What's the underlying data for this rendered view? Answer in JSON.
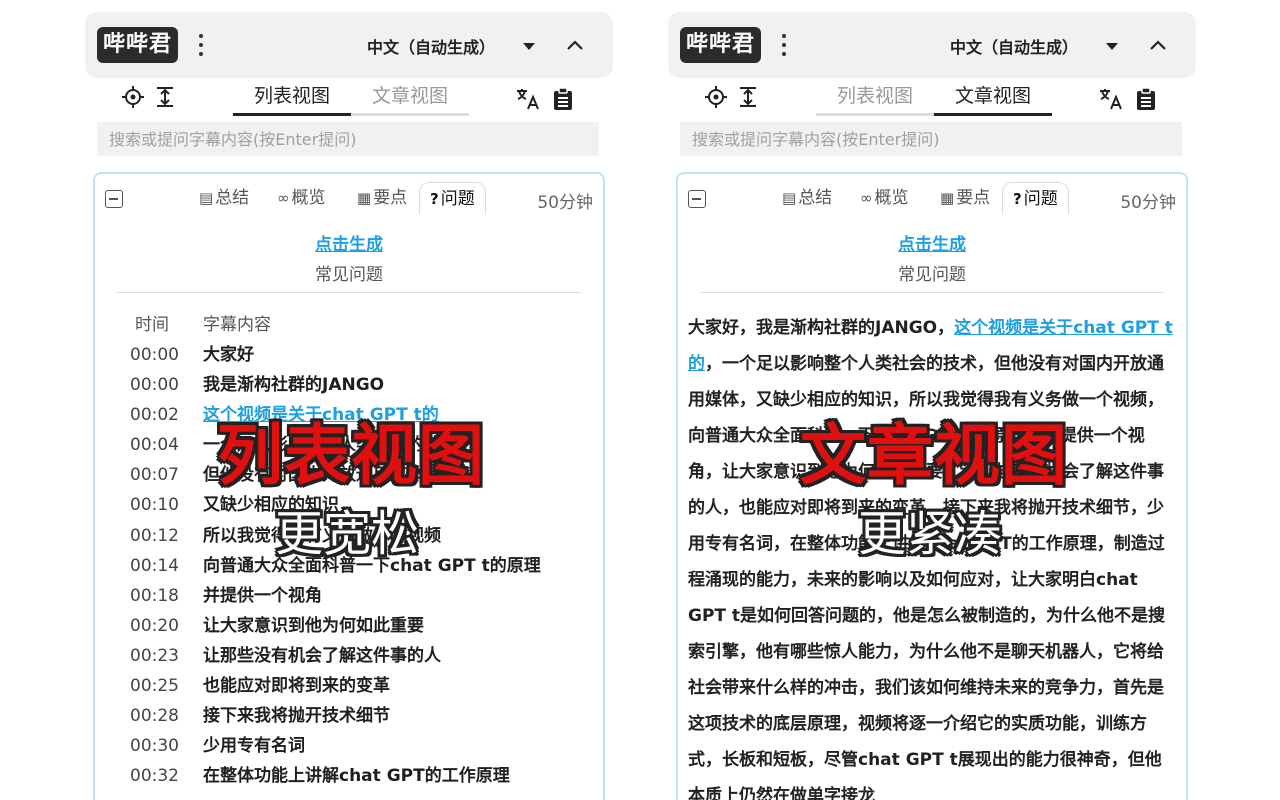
{
  "app": {
    "logo": "哔哔君",
    "language": "中文（自动生成）",
    "search_placeholder": "搜索或提问字幕内容(按Enter提问)"
  },
  "view_tabs": [
    "列表视图",
    "文章视图"
  ],
  "card": {
    "tabs": [
      "总结",
      "概览",
      "要点",
      "问题"
    ],
    "active_tab": "问题",
    "duration": "50分钟",
    "generate_link": "点击生成",
    "generate_sub": "常见问题"
  },
  "left_panel": {
    "active_view": "列表视图",
    "table_headers": {
      "time": "时间",
      "content": "字幕内容"
    },
    "rows": [
      {
        "time": "00:00",
        "text": "大家好"
      },
      {
        "time": "00:00",
        "text": "我是渐构社群的JANGO"
      },
      {
        "time": "00:02",
        "text": "这个视频是关于chat GPT t的"
      },
      {
        "time": "00:04",
        "text": "一个足以影响整个人类社会的技术"
      },
      {
        "time": "00:07",
        "text": "但他没有对国内开放通用媒体"
      },
      {
        "time": "00:10",
        "text": "又缺少相应的知识"
      },
      {
        "time": "00:12",
        "text": "所以我觉得我有义务做一个视频"
      },
      {
        "time": "00:14",
        "text": "向普通大众全面科普一下chat GPT t的原理"
      },
      {
        "time": "00:18",
        "text": "并提供一个视角"
      },
      {
        "time": "00:20",
        "text": "让大家意识到他为何如此重要"
      },
      {
        "time": "00:23",
        "text": "让那些没有机会了解这件事的人"
      },
      {
        "time": "00:25",
        "text": "也能应对即将到来的变革"
      },
      {
        "time": "00:28",
        "text": "接下来我将抛开技术细节"
      },
      {
        "time": "00:30",
        "text": "少用专有名词"
      },
      {
        "time": "00:32",
        "text": "在整体功能上讲解chat GPT的工作原理"
      }
    ],
    "overlay_title": "列表视图",
    "overlay_sub": "更宽松"
  },
  "right_panel": {
    "active_view": "文章视图",
    "article_lead": " 大家好，我是渐构社群的JANGO，",
    "article_link": "这个视频是关于chat GPT t的",
    "article_body": "，一个足以影响整个人类社会的技术，但他没有对国内开放通用媒体，又缺少相应的知识，所以我觉得我有义务做一个视频，向普通大众全面科普一下chat GPT t的原理，并提供一个视角，让大家意识到他为何如此重要，让那些没有机会了解这件事的人，也能应对即将到来的变革，接下来我将抛开技术细节，少用专有名词，在整体功能上讲解chat GPT的工作原理，制造过程涌现的能力，未来的影响以及如何应对，让大家明白chat GPT t是如何回答问题的，他是怎么被制造的，为什么他不是搜索引擎，他有哪些惊人能力，为什么他不是聊天机器人，它将给社会带来什么样的冲击，我们该如何维持未来的竞争力，首先是这项技术的底层原理，视频将逐一介绍它的实质功能，训练方式，长板和短板，尽管chat GPT t展现出的能力很神奇，但他本质上仍然在做单字接龙",
    "overlay_title": "文章视图",
    "overlay_sub": "更紧凑"
  },
  "colors": {
    "link": "#1e9fe0",
    "overlay_red": "#e11010",
    "card_border": "#bfe3f3"
  },
  "icons": [
    "locate-icon",
    "scroll-align-icon",
    "translate-icon",
    "clipboard-icon",
    "summary-icon",
    "binoculars-icon",
    "keypoints-icon",
    "question-icon",
    "chevron-up-icon",
    "more-icon",
    "dropdown-icon"
  ]
}
